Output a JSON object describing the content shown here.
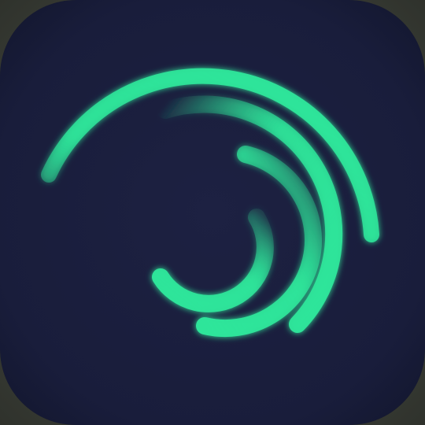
{
  "app_icon": {
    "icon": "swirl-arcs-logo-icon",
    "colors": {
      "background": "#1b1f3e",
      "background_edge": "#161a35",
      "accent": "#2ee59a",
      "accent_glow": "#1fc987"
    }
  }
}
